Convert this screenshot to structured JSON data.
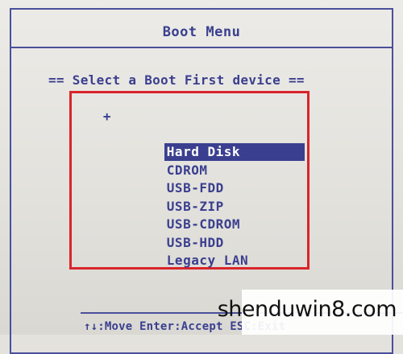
{
  "window": {
    "title": "Boot Menu"
  },
  "prompt": "== Select a Boot First device ==",
  "devices": [
    {
      "label": "Hard Disk",
      "marker": "+",
      "selected": true
    },
    {
      "label": "CDROM",
      "marker": "",
      "selected": false
    },
    {
      "label": "USB-FDD",
      "marker": "",
      "selected": false
    },
    {
      "label": "USB-ZIP",
      "marker": "",
      "selected": false
    },
    {
      "label": "USB-CDROM",
      "marker": "",
      "selected": false
    },
    {
      "label": "USB-HDD",
      "marker": "",
      "selected": false
    },
    {
      "label": "Legacy LAN",
      "marker": "",
      "selected": false
    }
  ],
  "footer": {
    "text": "↑↓:Move Enter:Accept ESC:Exit"
  },
  "watermark": {
    "text": "shenduwin8.com"
  },
  "colors": {
    "text": "#3b3f8f",
    "highlight_box": "#d9252a",
    "selection_bg": "#3b3f8f",
    "background": "#e4e2dd"
  }
}
